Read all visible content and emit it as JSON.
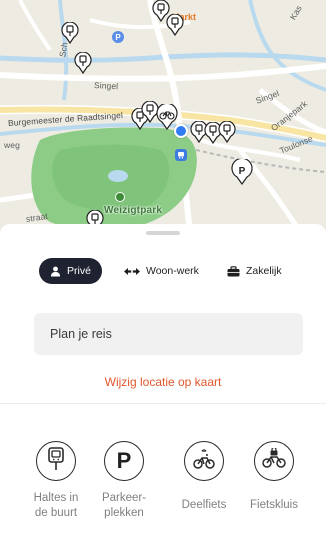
{
  "map": {
    "labels": {
      "markt": "Markt",
      "singel_top": "Singel",
      "burgemeester": "Burgemeester de Raadtsingel",
      "weg": "weg",
      "singel_right": "Singel",
      "oranjepark": "Oranjepark",
      "toulonselaan": "Toulonse",
      "kas": "Kas",
      "straat": "straat",
      "park": "Weizigtpark",
      "scholp": "Sch"
    }
  },
  "tabs": [
    {
      "label": "Privé",
      "icon": "person-icon",
      "active": true
    },
    {
      "label": "Woon-werk",
      "icon": "commute-arrows-icon",
      "active": false
    },
    {
      "label": "Zakelijk",
      "icon": "briefcase-icon",
      "active": false
    }
  ],
  "search": {
    "placeholder": "Plan je reis"
  },
  "change_location": "Wijzig locatie op kaart",
  "quick_actions": [
    {
      "line1": "Haltes in",
      "line2": "de buurt",
      "icon": "bus-stop-icon"
    },
    {
      "line1": "Parkeer-",
      "line2": "plekken",
      "icon": "parking-icon"
    },
    {
      "line1": "Deelfiets",
      "line2": "",
      "icon": "shared-bike-icon"
    },
    {
      "line1": "Fietskluis",
      "line2": "",
      "icon": "bike-locker-icon"
    }
  ],
  "colors": {
    "accent": "#e0572c",
    "active_tab": "#1f2230",
    "user_location": "#2f7cf6",
    "park": "#7fc47a"
  }
}
